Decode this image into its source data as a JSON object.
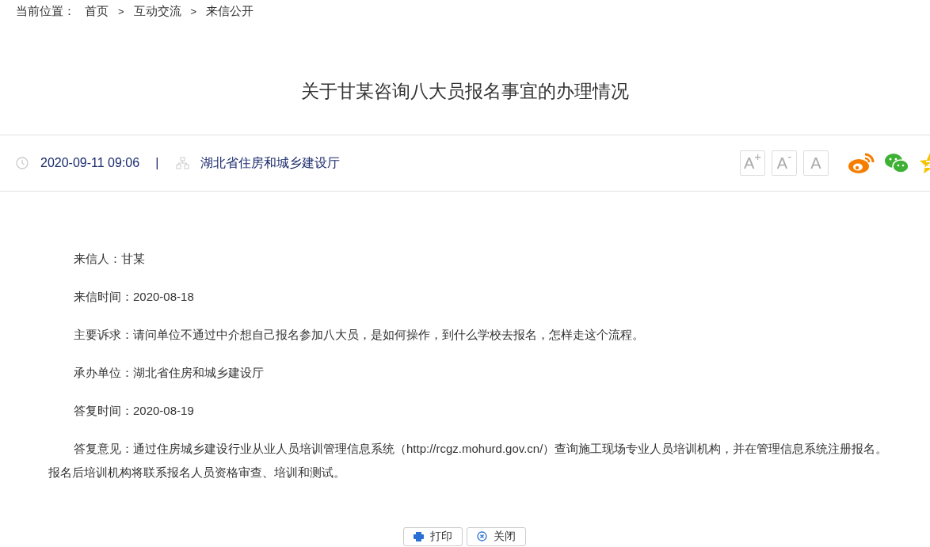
{
  "breadcrumb": {
    "label": "当前位置：",
    "items": [
      "首页",
      "互动交流",
      "来信公开"
    ],
    "separator": ">"
  },
  "title": "关于甘某咨询八大员报名事宜的办理情况",
  "meta": {
    "date": "2020-09-11 09:06",
    "divider": "|",
    "department": "湖北省住房和城乡建设厅"
  },
  "font_buttons": [
    "A$^{+}$",
    "A$^{-}$",
    "A"
  ],
  "share": [
    {
      "kind": "weibo"
    },
    {
      "kind": "wechat"
    },
    {
      "kind": "qzone"
    }
  ],
  "paragraphs": [
    "来信人：甘某",
    "来信时间：2020-08-18",
    "主要诉求：请问单位不通过中介想自己报名参加八大员，是如何操作，到什么学校去报名，怎样走这个流程。",
    "承办单位：湖北省住房和城乡建设厅",
    "答复时间：2020-08-19",
    "答复意见：通过住房城乡建设行业从业人员培训管理信息系统（http://rcgz.mohurd.gov.cn/）查询施工现场专业人员培训机构，并在管理信息系统注册报名。报名后培训机构将联系报名人员资格审查、培训和测试。"
  ],
  "buttons": [
    {
      "kind": "print",
      "label": "打印"
    },
    {
      "kind": "close",
      "label": "关闭"
    }
  ]
}
